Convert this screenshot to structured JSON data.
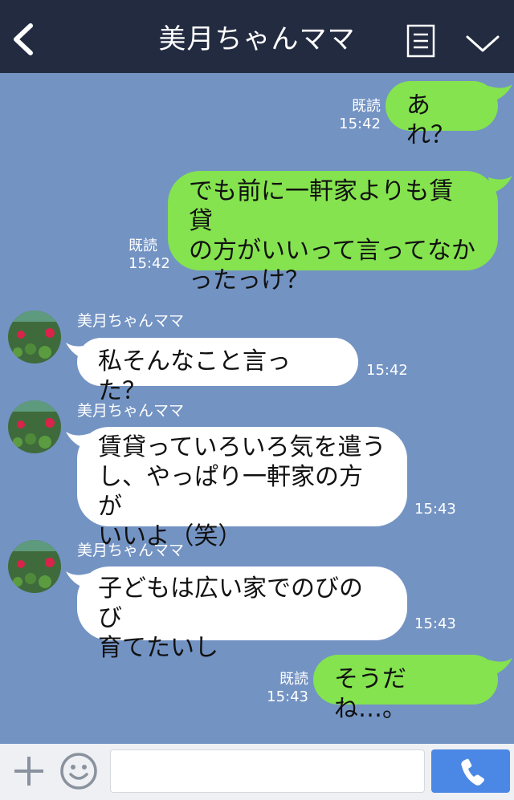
{
  "header": {
    "title": "美月ちゃんママ",
    "back_icon": "chevron-left-icon",
    "menu_icon": "list-icon",
    "collapse_icon": "chevron-down-icon"
  },
  "colors": {
    "header_bg": "#232b41",
    "chat_bg": "#7393c3",
    "sent_bubble": "#84e34e",
    "received_bubble": "#ffffff",
    "call_button": "#4b88e6"
  },
  "messages": [
    {
      "direction": "sent",
      "lines": [
        "あれ？"
      ],
      "read": "既読",
      "time": "15:42"
    },
    {
      "direction": "sent",
      "lines": [
        "でも前に一軒家よりも賃貸",
        "の方がいいって言ってなか",
        "ったっけ？"
      ],
      "read": "既読",
      "time": "15:42"
    },
    {
      "direction": "received",
      "sender": "美月ちゃんママ",
      "lines": [
        "私そんなこと言った？"
      ],
      "time": "15:42"
    },
    {
      "direction": "received",
      "sender": "美月ちゃんママ",
      "lines": [
        "賃貸っていろいろ気を遣う",
        "し、やっぱり一軒家の方が",
        "いいよ（笑）"
      ],
      "time": "15:43"
    },
    {
      "direction": "received",
      "sender": "美月ちゃんママ",
      "lines": [
        "子どもは広い家でのびのび",
        "育てたいし"
      ],
      "time": "15:43"
    },
    {
      "direction": "sent",
      "lines": [
        "そうだね…。"
      ],
      "read": "既読",
      "time": "15:43"
    }
  ],
  "footer": {
    "plus_icon": "plus-icon",
    "emoji_icon": "smiley-icon",
    "input_value": "",
    "call_icon": "phone-icon"
  }
}
